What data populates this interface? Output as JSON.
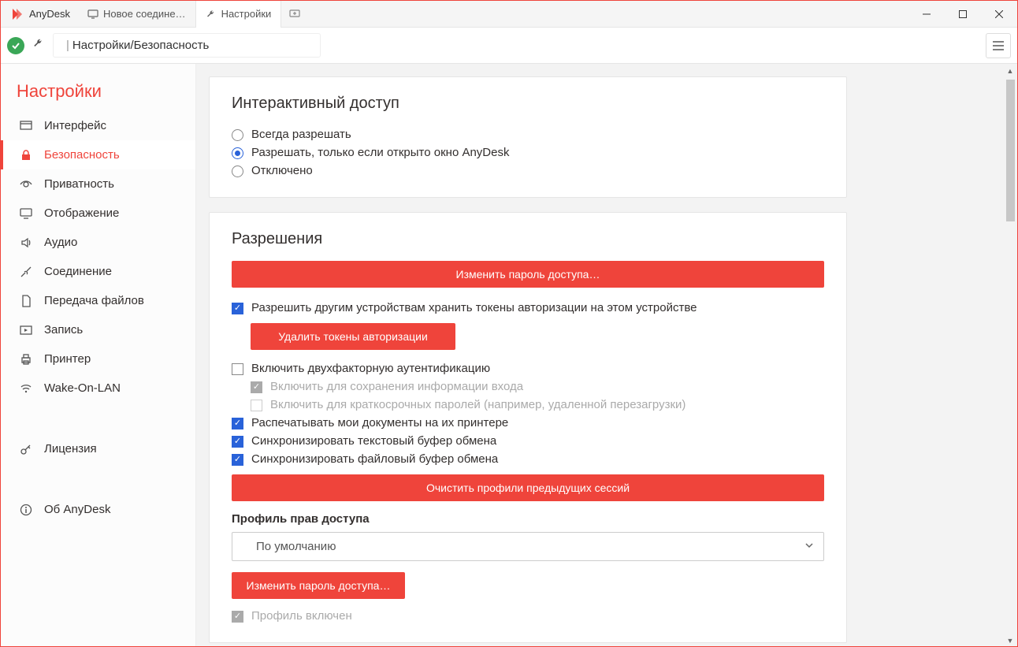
{
  "app": {
    "name": "AnyDesk"
  },
  "tabs": [
    {
      "label": "Новое соедине…"
    },
    {
      "label": "Настройки"
    }
  ],
  "breadcrumb": {
    "root": "Настройки",
    "leaf": "Безопасность"
  },
  "sidebar": {
    "title": "Настройки",
    "items": [
      {
        "label": "Интерфейс"
      },
      {
        "label": "Безопасность"
      },
      {
        "label": "Приватность"
      },
      {
        "label": "Отображение"
      },
      {
        "label": "Аудио"
      },
      {
        "label": "Соединение"
      },
      {
        "label": "Передача файлов"
      },
      {
        "label": "Запись"
      },
      {
        "label": "Принтер"
      },
      {
        "label": "Wake-On-LAN"
      }
    ],
    "license": {
      "label": "Лицензия"
    },
    "about": {
      "label": "Об AnyDesk"
    }
  },
  "sections": {
    "interactive": {
      "title": "Интерактивный доступ",
      "options": [
        "Всегда разрешать",
        "Разрешать, только если открыто окно AnyDesk",
        "Отключено"
      ]
    },
    "permissions": {
      "title": "Разрешения",
      "change_password": "Изменить пароль доступа…",
      "allow_tokens": "Разрешить другим устройствам хранить токены авторизации на этом устройстве",
      "delete_tokens": "Удалить токены авторизации",
      "twofa": "Включить двухфакторную аутентификацию",
      "twofa_save": "Включить для сохранения информации входа",
      "twofa_temp": "Включить для краткосрочных паролей (например, удаленной перезагрузки)",
      "print": "Распечатывать мои документы на их принтере",
      "sync_text": "Синхронизировать текстовый буфер обмена",
      "sync_file": "Синхронизировать файловый буфер обмена",
      "clear_profiles": "Очистить профили предыдущих сессий",
      "profile_label": "Профиль прав доступа",
      "profile_value": "По умолчанию",
      "change_password2": "Изменить пароль доступа…",
      "profile_enabled": "Профиль включен"
    }
  }
}
